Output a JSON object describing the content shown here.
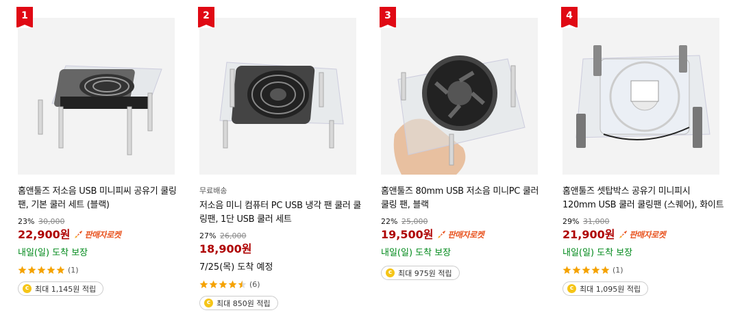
{
  "products": [
    {
      "rank": "1",
      "image_icon": "fan-stand-black-icon",
      "free_shipping": "",
      "title": "홈앤툴즈 저소음 USB 미니피씨 공유기 쿨링팬, 기본 쿨러 세트 (블랙)",
      "discount": "23%",
      "original_price": "30,000",
      "price": "22,900원",
      "badge": "판매자로켓",
      "delivery": "내일(일) 도착 보장",
      "delivery_color": "#00891a",
      "rating": 5,
      "review_count": "(1)",
      "cashback": "최대 1,145원 적립"
    },
    {
      "rank": "2",
      "image_icon": "fan-stand-gray-icon",
      "free_shipping": "무료배송",
      "title": "저소음 미니 컴퓨터 PC USB 냉각 팬 쿨러 쿨링팬, 1단 USB 쿨러 세트",
      "discount": "27%",
      "original_price": "26,000",
      "price": "18,900원",
      "badge": "",
      "delivery": "7/25(목) 도착 예정",
      "delivery_color": "#111111",
      "rating": 4.5,
      "review_count": "(6)",
      "cashback": "최대 850원 적립"
    },
    {
      "rank": "3",
      "image_icon": "fan-hand-held-icon",
      "free_shipping": "",
      "title": "홈앤툴즈 80mm USB 저소음 미니PC 쿨러 쿨링 팬, 블랙",
      "discount": "22%",
      "original_price": "25,000",
      "price": "19,500원",
      "badge": "판매자로켓",
      "delivery": "내일(일) 도착 보장",
      "delivery_color": "#00891a",
      "rating": null,
      "review_count": "",
      "cashback": "최대 975원 적립"
    },
    {
      "rank": "4",
      "image_icon": "fan-clear-120mm-icon",
      "free_shipping": "",
      "title": "홈앤툴즈 셋탑박스 공유기 미니피시 120mm USB 쿨러 쿨링팬 (스퀘어), 화이트",
      "discount": "29%",
      "original_price": "31,000",
      "price": "21,900원",
      "badge": "판매자로켓",
      "delivery": "내일(일) 도착 보장",
      "delivery_color": "#00891a",
      "rating": 5,
      "review_count": "(1)",
      "cashback": "최대 1,095원 적립"
    }
  ],
  "colors": {
    "rank_badge": "#e00914",
    "price": "#ae0000",
    "rocket": "#e8531f",
    "guaranteed_delivery": "#00891a",
    "star": "#f5a200",
    "coin": "#f5c518"
  }
}
